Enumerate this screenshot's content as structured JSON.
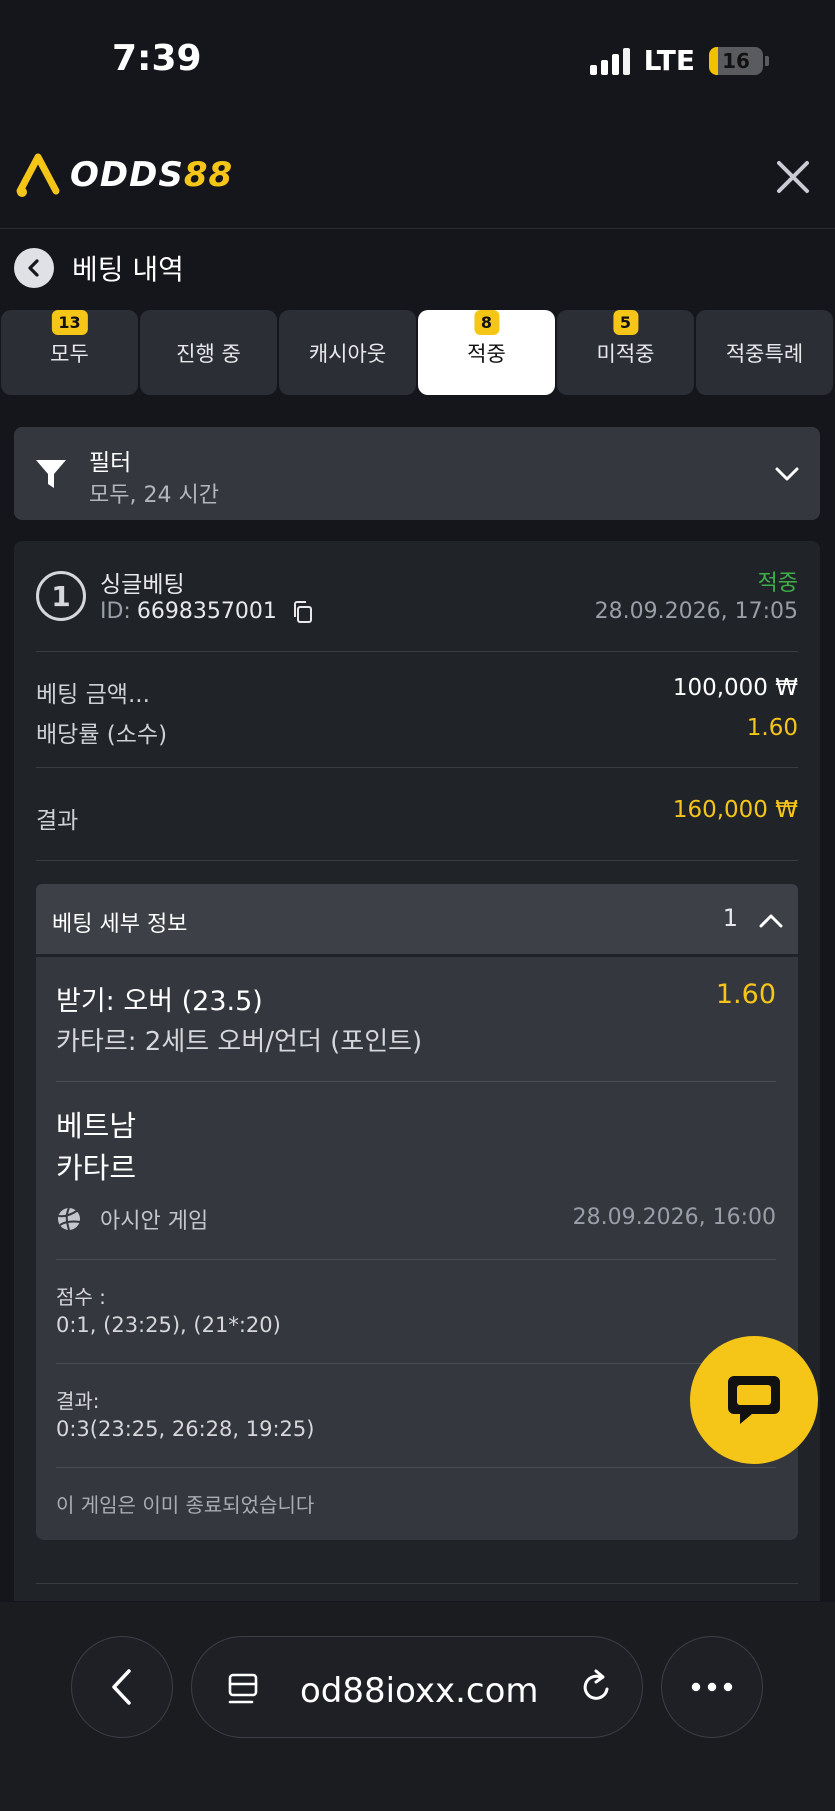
{
  "status_bar": {
    "time": "7:39",
    "network": "LTE",
    "battery": "16",
    "battery_level": 0.16
  },
  "header": {
    "logo_text_a": "ODDS",
    "logo_text_b": "88",
    "close_icon": "close-icon"
  },
  "page": {
    "title": "베팅 내역"
  },
  "tabs": [
    {
      "label": "모두",
      "badge": "13"
    },
    {
      "label": "진행 중",
      "badge": ""
    },
    {
      "label": "캐시아웃",
      "badge": ""
    },
    {
      "label": "적중",
      "badge": "8",
      "active": true
    },
    {
      "label": "미적중",
      "badge": "5"
    },
    {
      "label": "적중특례",
      "badge": ""
    }
  ],
  "filter": {
    "title": "필터",
    "value": "모두, 24 시간"
  },
  "bet": {
    "type": "싱글베팅",
    "id_label": "ID:",
    "id_value": "6698357001",
    "status": "적중",
    "datetime": "28.09.2026, 17:05",
    "stake_label": "베팅 금액...",
    "stake_value": "100,000 ₩",
    "odds_label": "배당률 (소수)",
    "odds_value": "1.60",
    "result_label": "결과",
    "result_value": "160,000 ₩"
  },
  "details": {
    "title": "베팅 세부 정보",
    "count": "1",
    "pick": "받기: 오버 (23.5)",
    "pick_odds": "1.60",
    "market": "카타르: 2세트 오버/언더 (포인트)",
    "team_home": "베트남",
    "team_away": "카타르",
    "league": "아시안 게임",
    "match_datetime": "28.09.2026, 16:00",
    "score_label": "점수 :",
    "score_value": "0:1, (23:25), (21*:20)",
    "result_label": "결과:",
    "result_value": "0:3(23:25, 26:28, 19:25)",
    "ended_note": "이 게임은 이미 종료되었습니다"
  },
  "browser": {
    "url": "od88ioxx.com"
  },
  "colors": {
    "accent": "#f5c518",
    "won": "#3fae49",
    "bg": "#14161b",
    "card": "#202328"
  }
}
